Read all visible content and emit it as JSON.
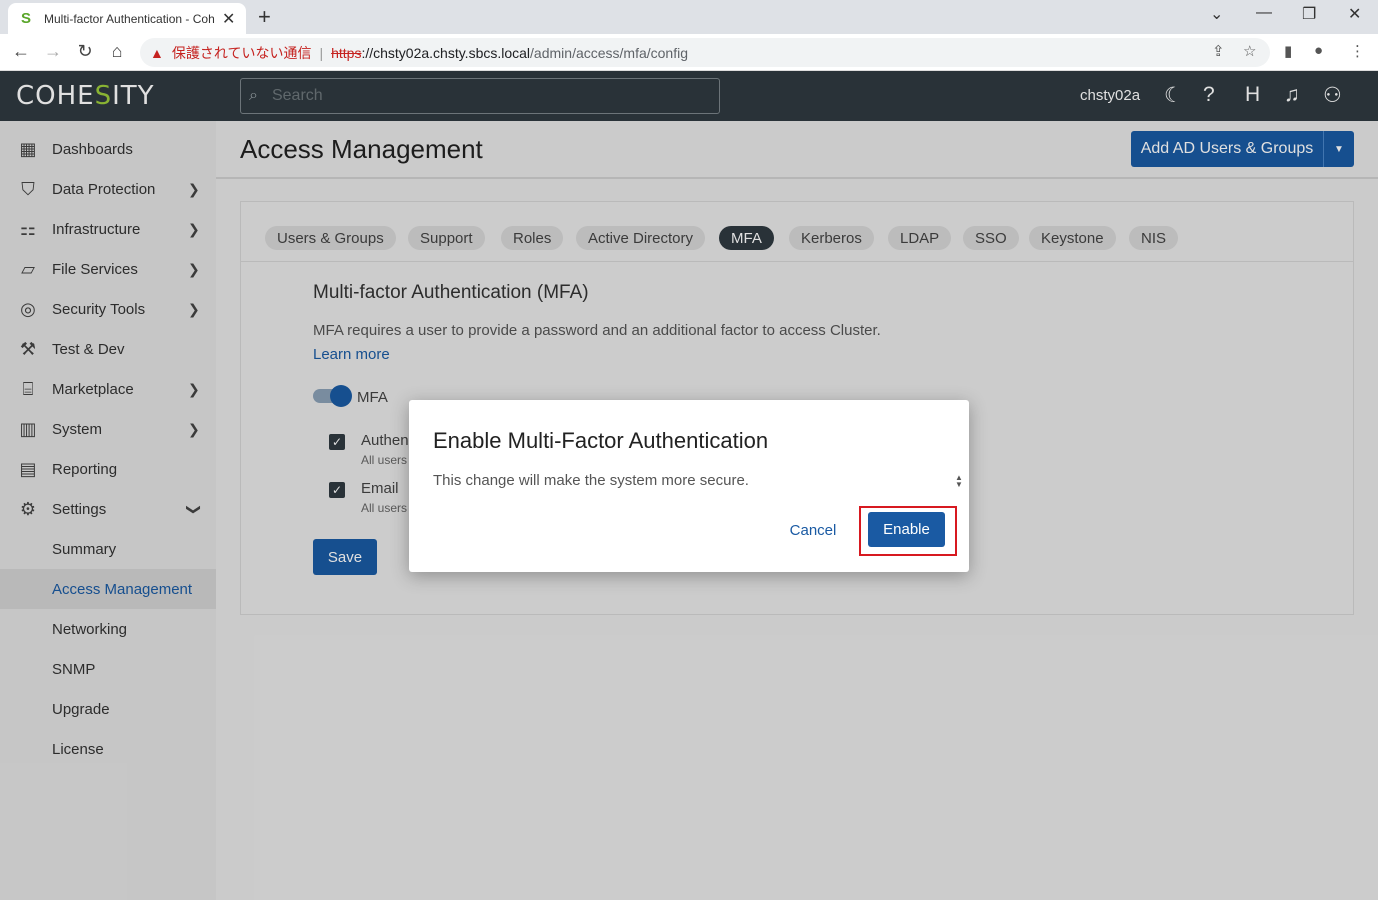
{
  "browser": {
    "tab_title": "Multi-factor Authentication - Coh",
    "new_tab": "+",
    "warning_text": "保護されていない通信",
    "url_scheme": "https",
    "url_host": "://chsty02a.chsty.sbcs.local",
    "url_path": "/admin/access/mfa/config"
  },
  "header": {
    "logo_pre": "COHE",
    "logo_s": "S",
    "logo_post": "ITY",
    "search_placeholder": "Search",
    "username": "chsty02a"
  },
  "sidebar": {
    "items": [
      {
        "label": "Dashboards",
        "icon": "dashboard-icon"
      },
      {
        "label": "Data Protection",
        "icon": "shield-icon"
      },
      {
        "label": "Infrastructure",
        "icon": "infrastructure-icon"
      },
      {
        "label": "File Services",
        "icon": "folder-icon"
      },
      {
        "label": "Security Tools",
        "icon": "fingerprint-icon"
      },
      {
        "label": "Test & Dev",
        "icon": "wrench-icon"
      },
      {
        "label": "Marketplace",
        "icon": "store-icon"
      },
      {
        "label": "System",
        "icon": "system-icon"
      },
      {
        "label": "Reporting",
        "icon": "chart-icon"
      },
      {
        "label": "Settings",
        "icon": "gear-icon"
      },
      {
        "label": "Summary"
      },
      {
        "label": "Access Management"
      },
      {
        "label": "Networking"
      },
      {
        "label": "SNMP"
      },
      {
        "label": "Upgrade"
      },
      {
        "label": "License"
      }
    ]
  },
  "page": {
    "title": "Access Management",
    "add_button": "Add AD Users & Groups",
    "tabs": [
      "Users & Groups",
      "Support",
      "Roles",
      "Active Directory",
      "MFA",
      "Kerberos",
      "LDAP",
      "SSO",
      "Keystone",
      "NIS"
    ],
    "active_tab": "MFA"
  },
  "mfa": {
    "title": "Multi-factor Authentication (MFA)",
    "description": "MFA requires a user to provide a password and an additional factor to access Cluster.",
    "learn_more": "Learn more",
    "toggle_label": "MFA",
    "option1_label": "Authen",
    "option1_sub": "All users",
    "option2_label": "Email",
    "option2_sub": "All users",
    "save": "Save"
  },
  "dialog": {
    "title": "Enable Multi-Factor Authentication",
    "body": "This change will make the system more secure.",
    "cancel": "Cancel",
    "enable": "Enable"
  },
  "colors": {
    "primary": "#1a5aa3",
    "header_bg": "#2f3a40",
    "highlight": "#d71920"
  }
}
